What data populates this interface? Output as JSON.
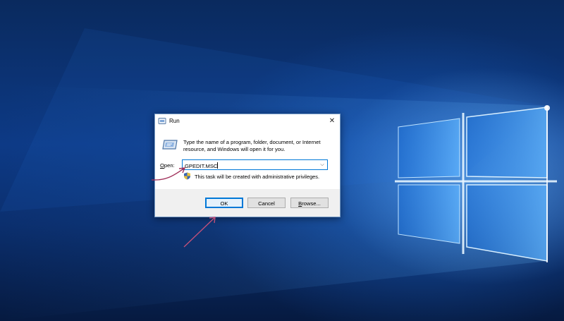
{
  "dialog": {
    "title": "Run",
    "description": "Type the name of a program, folder, document, or Internet resource, and Windows will open it for you.",
    "open_label_mnemonic": "O",
    "open_label_rest": "pen:",
    "open_value": "GPEDIT.MSC",
    "admin_note": "This task will be created with administrative privileges.",
    "buttons": {
      "ok": "OK",
      "cancel": "Cancel",
      "browse_mnemonic": "B",
      "browse_rest": "rowse..."
    }
  },
  "icons": {
    "title": "run-icon",
    "dialog": "run-program-icon",
    "shield": "uac-shield-icon",
    "close": "close-icon",
    "dropdown": "chevron-down-icon"
  },
  "colors": {
    "desktop_dark": "#0a2a5e",
    "desktop_light": "#7ec3ff",
    "accent": "#0078d7",
    "annotation_arrow": "#a0305a"
  }
}
